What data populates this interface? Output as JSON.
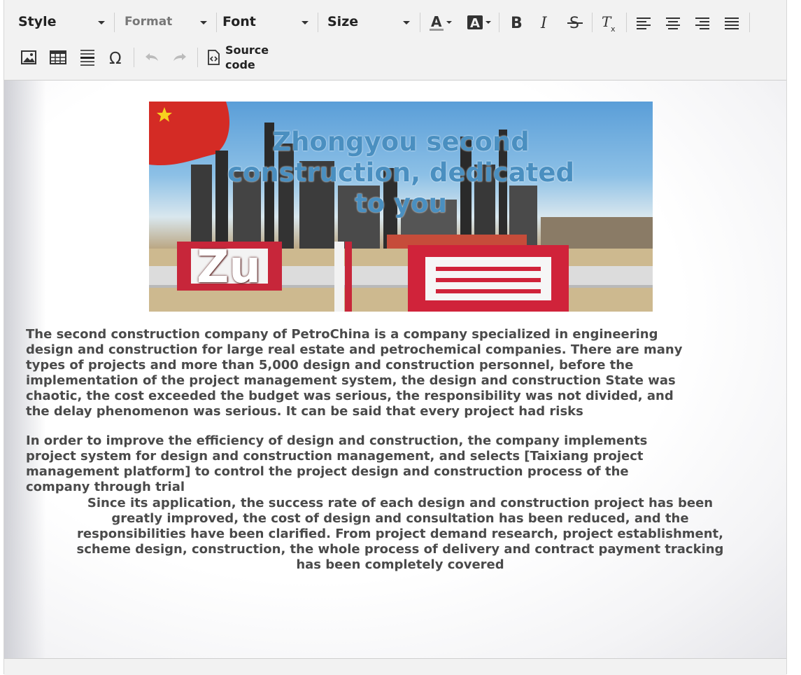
{
  "toolbar": {
    "style_label": "Style",
    "format_label": "Format",
    "font_label": "Font",
    "size_label": "Size",
    "source_code_label": "Source code",
    "icons": [
      "text-color-icon",
      "background-color-icon",
      "bold-icon",
      "italic-icon",
      "strikethrough-icon",
      "clear-formatting-icon",
      "align-left-icon",
      "align-center-icon",
      "align-right-icon",
      "align-justify-icon",
      "image-icon",
      "table-icon",
      "horizontal-line-icon",
      "special-character-icon",
      "undo-icon",
      "redo-icon",
      "source-code-icon"
    ]
  },
  "content": {
    "banner": {
      "title": "Zhongyou second construction, dedicated to you",
      "overlay_text": "Zu"
    },
    "paragraphs": [
      "The second construction company of PetroChina is a company specialized in engineering design and construction for large real estate and petrochemical companies. There are many types of projects and more than 5,000 design and construction personnel, before the implementation of the project management system, the design and construction State was chaotic, the cost exceeded the budget was serious, the responsibility was not divided, and the delay phenomenon was serious. It can be said that every project had risks",
      "In order to improve the efficiency of design and construction, the company implements project system for design and construction management, and selects [Taixiang project management platform] to control the project design and construction process of the company through trial",
      "Since its application, the success rate of each design and construction project has been greatly improved, the cost of design and consultation has been reduced, and the responsibilities have been clarified. From project demand research, project establishment, scheme design, construction, the whole process of delivery and contract payment tracking has been completely covered"
    ]
  },
  "colors": {
    "toolbar_bg": "#f2f2f2",
    "text": "#4a4a4a",
    "banner_title": "#4a8fc0"
  }
}
